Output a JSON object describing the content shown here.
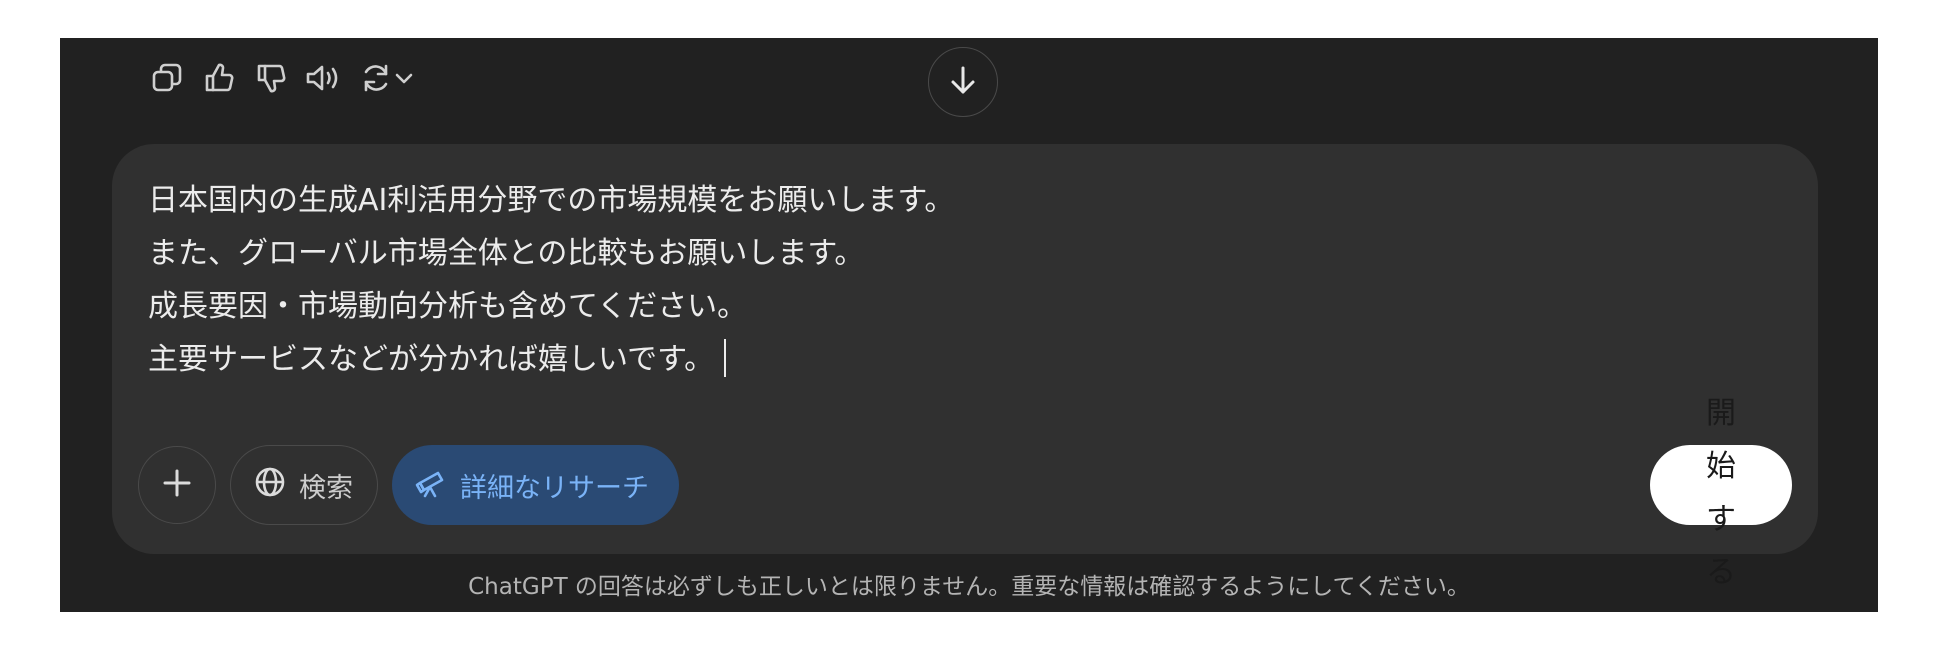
{
  "message_actions": {
    "icons": [
      "copy-icon",
      "thumbs-up-icon",
      "thumbs-down-icon",
      "speaker-icon",
      "regenerate-icon",
      "chevron-down-icon"
    ]
  },
  "scroll_down": {
    "icon": "arrow-down-icon"
  },
  "composer": {
    "prompt_lines": [
      "日本国内の生成AI利活用分野での市場規模をお願いします。",
      "また、グローバル市場全体との比較もお願いします。",
      "成長要因・市場動向分析も含めてください。",
      "主要サービスなどが分かれば嬉しいです。"
    ],
    "add_icon": "plus-icon",
    "search_label": "検索",
    "search_icon": "globe-icon",
    "research_label": "詳細なリサーチ",
    "research_icon": "telescope-icon",
    "start_label": "開始する"
  },
  "disclaimer": "ChatGPT の回答は必ずしも正しいとは限りません。重要な情報は確認するようにしてください。",
  "colors": {
    "background": "#212121",
    "composer": "#303030",
    "research_pill_bg": "#2a4a74",
    "research_pill_text": "#7ab3f7"
  }
}
